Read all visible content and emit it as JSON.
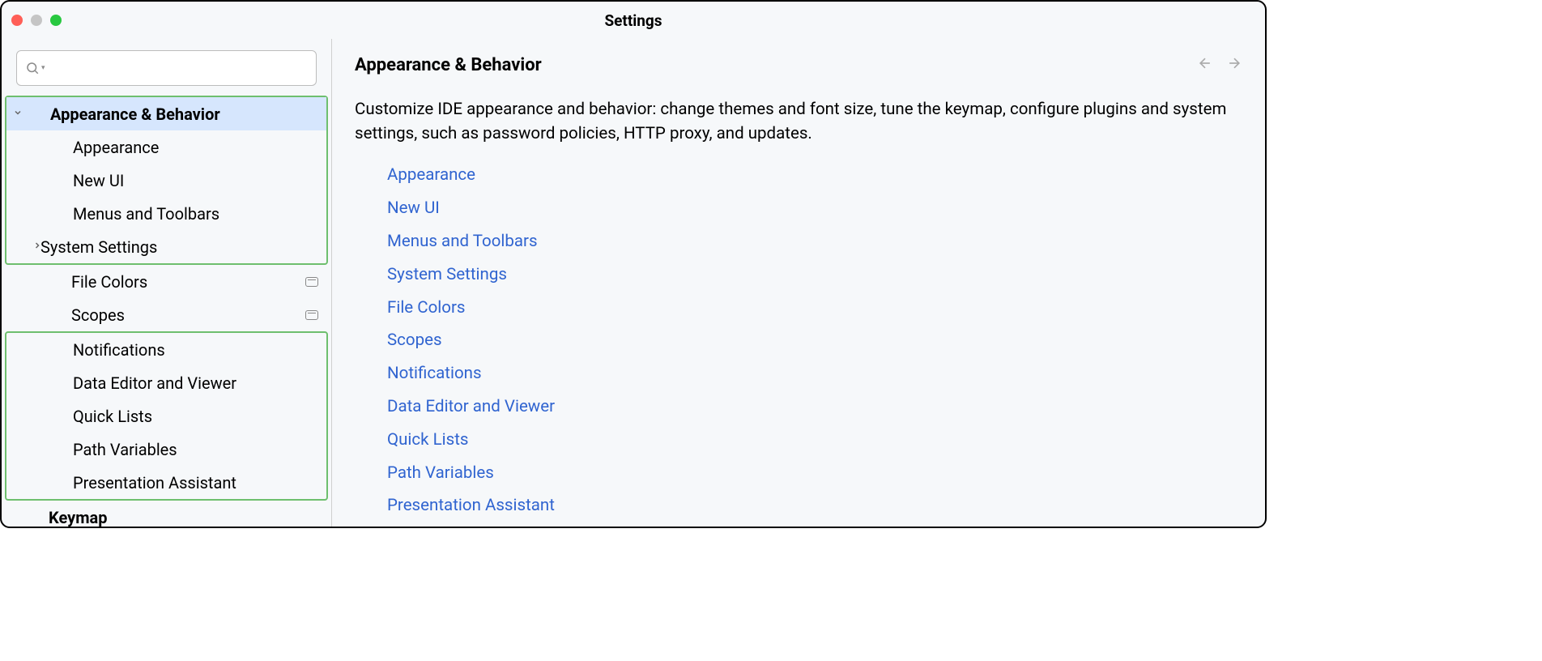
{
  "window": {
    "title": "Settings"
  },
  "sidebar": {
    "search_placeholder": "",
    "items": [
      {
        "label": "Appearance & Behavior",
        "top": true,
        "selected": true,
        "chevron": "down"
      },
      {
        "label": "Appearance",
        "child": true
      },
      {
        "label": "New UI",
        "child": true
      },
      {
        "label": "Menus and Toolbars",
        "child": true
      },
      {
        "label": "System Settings",
        "child": true,
        "chevron": "right"
      },
      {
        "label": "File Colors",
        "child": true,
        "badge": true
      },
      {
        "label": "Scopes",
        "child": true,
        "badge": true
      },
      {
        "label": "Notifications",
        "child": true
      },
      {
        "label": "Data Editor and Viewer",
        "child": true
      },
      {
        "label": "Quick Lists",
        "child": true
      },
      {
        "label": "Path Variables",
        "child": true
      },
      {
        "label": "Presentation Assistant",
        "child": true
      },
      {
        "label": "Keymap",
        "top": true
      }
    ]
  },
  "main": {
    "title": "Appearance & Behavior",
    "description": "Customize IDE appearance and behavior: change themes and font size, tune the keymap, configure plugins and system settings, such as password policies, HTTP proxy, and updates.",
    "links": [
      "Appearance",
      "New UI",
      "Menus and Toolbars",
      "System Settings",
      "File Colors",
      "Scopes",
      "Notifications",
      "Data Editor and Viewer",
      "Quick Lists",
      "Path Variables",
      "Presentation Assistant"
    ]
  }
}
